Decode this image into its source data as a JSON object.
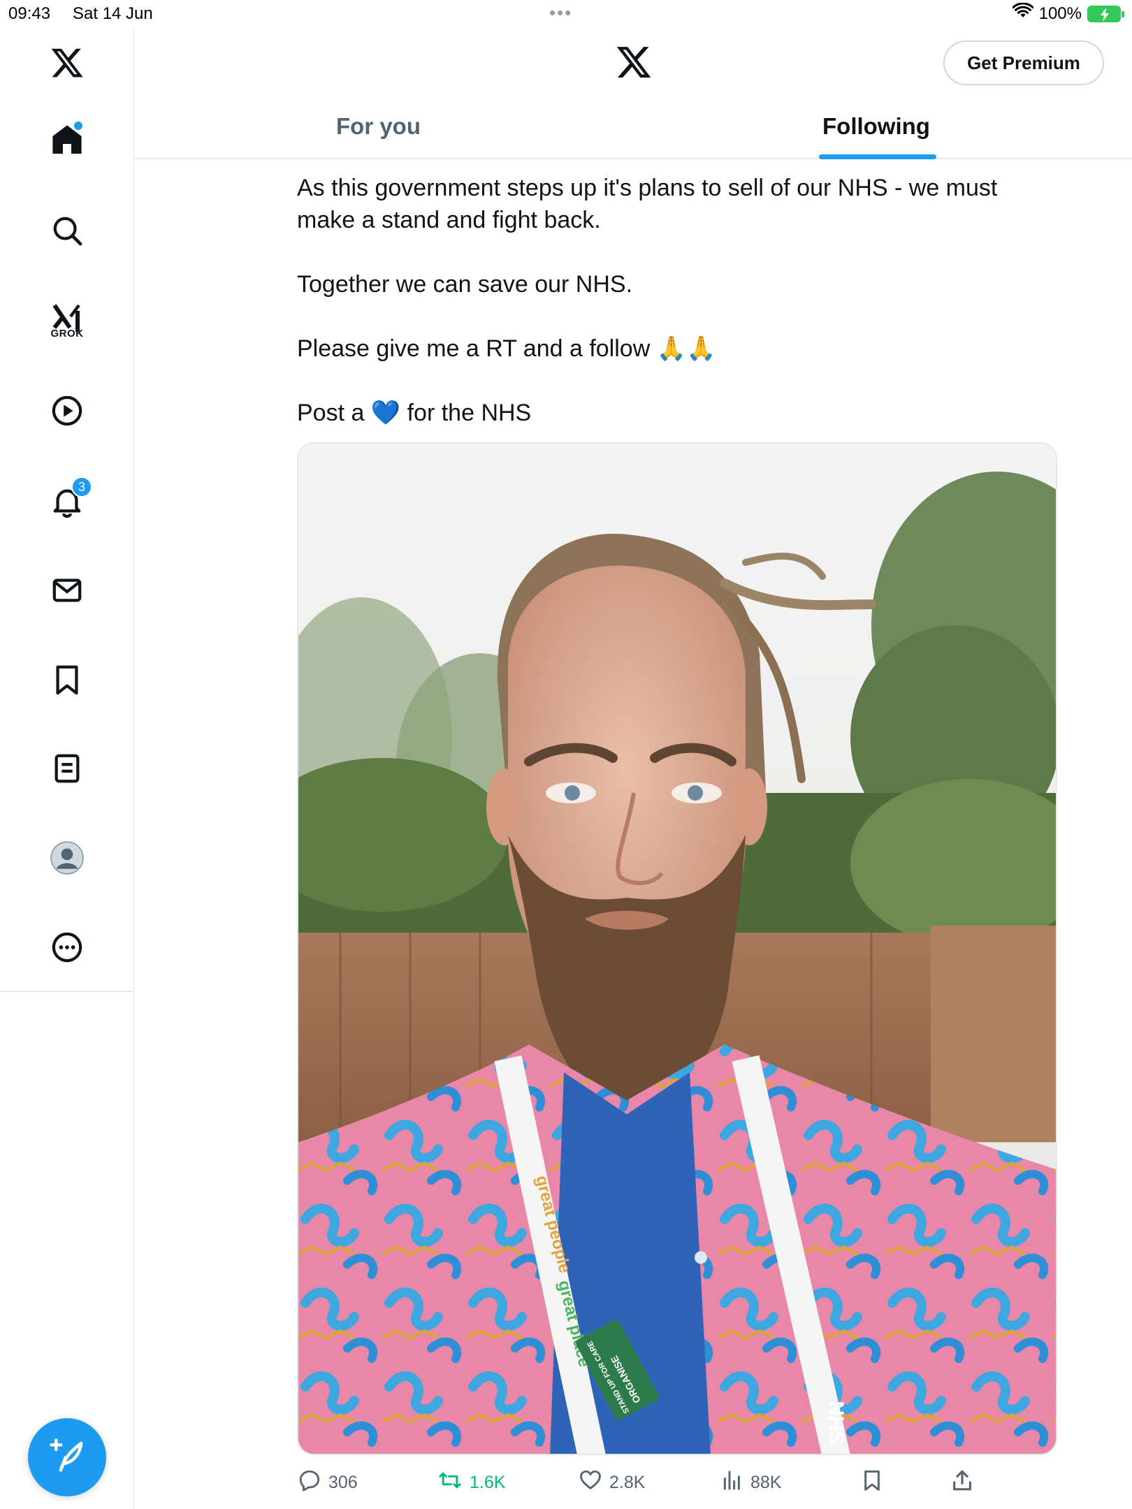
{
  "status_bar": {
    "time": "09:43",
    "date": "Sat 14 Jun",
    "battery": "100%",
    "icons": [
      "wifi-icon",
      "battery-charging-icon"
    ]
  },
  "sidebar": {
    "items": [
      {
        "name": "home",
        "icon": "home-icon",
        "badge": "dot"
      },
      {
        "name": "explore",
        "icon": "search-icon"
      },
      {
        "name": "grok",
        "icon": "grok-icon",
        "label": "GROK"
      },
      {
        "name": "videos",
        "icon": "play-icon"
      },
      {
        "name": "notifications",
        "icon": "bell-icon",
        "badge": "3"
      },
      {
        "name": "messages",
        "icon": "mail-icon"
      },
      {
        "name": "bookmarks",
        "icon": "bookmark-icon"
      },
      {
        "name": "lists",
        "icon": "list-icon"
      },
      {
        "name": "profile",
        "icon": "avatar-icon"
      },
      {
        "name": "more",
        "icon": "more-icon"
      }
    ],
    "compose_icon": "compose-icon"
  },
  "header": {
    "logo": "x-logo-icon",
    "premium_label": "Get Premium"
  },
  "tabs": [
    {
      "label": "For you",
      "active": false
    },
    {
      "label": "Following",
      "active": true
    }
  ],
  "post": {
    "lines": [
      "As this government steps up it's plans to sell of our NHS - we must",
      "make a stand and fight back.",
      "Together we can save our NHS.",
      "Please give me a RT and a follow 🙏🙏",
      "Post a 💙 for the NHS"
    ],
    "media": {
      "description_icon": "photo",
      "lanyard_text_1": "great people",
      "lanyard_text_2": "great place",
      "badge_text_1": "STAND UP FOR CARE",
      "badge_text_2": "ORGANISE",
      "lanyard_text_3": "NHS"
    },
    "stats": {
      "replies": "306",
      "reposts": "1.6K",
      "likes": "2.8K",
      "views": "88K"
    }
  },
  "colors": {
    "accent": "#1d9bf0",
    "repost": "#00ba7c",
    "muted": "#536471",
    "text": "#0f1419",
    "border": "#e6e9ec"
  }
}
